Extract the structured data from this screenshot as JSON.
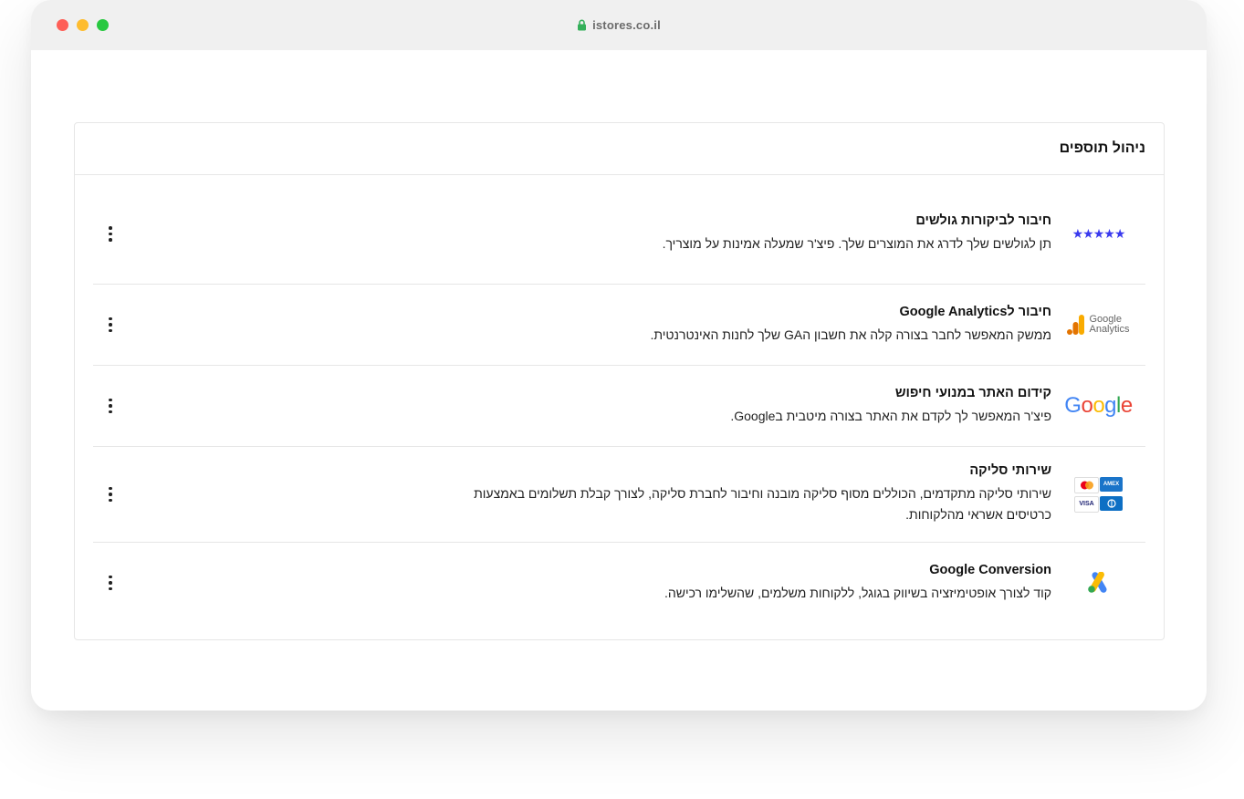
{
  "browser": {
    "url": "istores.co.il"
  },
  "panel": {
    "title": "ניהול תוספים"
  },
  "addons": [
    {
      "title": "חיבור לביקורות גולשים",
      "description": "תן לגולשים שלך לדרג את המוצרים שלך. פיצ'ר שמעלה אמינות על מוצריך.",
      "logo_icon": "stars-rating-icon",
      "logo_text": "★★★★★"
    },
    {
      "title": "חיבור לGoogle Analytics",
      "description": "ממשק המאפשר לחבר בצורה קלה את חשבון הGA שלך לחנות האינטרנטית.",
      "logo_icon": "google-analytics-logo",
      "logo_text_line1": "Google",
      "logo_text_line2": "Analytics"
    },
    {
      "title": "קידום האתר במנועי חיפוש",
      "description": "פיצ'ר המאפשר לך לקדם את האתר בצורה מיטבית בGoogle.",
      "logo_icon": "google-logo",
      "logo_letters": [
        "G",
        "o",
        "o",
        "g",
        "l",
        "e"
      ]
    },
    {
      "title": "שירותי סליקה",
      "description": "שירותי סליקה מתקדמים, הכוללים מסוף סליקה מובנה וחיבור לחברת סליקה, לצורך קבלת תשלומים באמצעות כרטיסים אשראי מהלקוחות.",
      "logo_icon": "credit-cards-logo",
      "card_labels": [
        "",
        "AMEX",
        "VISA",
        ""
      ]
    },
    {
      "title": "Google Conversion",
      "description": "קוד לצורך אופטימיזציה בשיווק בגוגל, ללקוחות משלמים, שהשלימו רכישה.",
      "logo_icon": "google-ads-logo"
    }
  ],
  "colors": {
    "star": "#3a3aee",
    "google_blue": "#4285F4",
    "google_red": "#EA4335",
    "google_yellow": "#FBBC05",
    "google_green": "#34A853",
    "ga_orange": "#F9AB00",
    "ga_dark_orange": "#E37400",
    "amex_blue": "#1a74c9",
    "visa_navy": "#1a1f71"
  }
}
